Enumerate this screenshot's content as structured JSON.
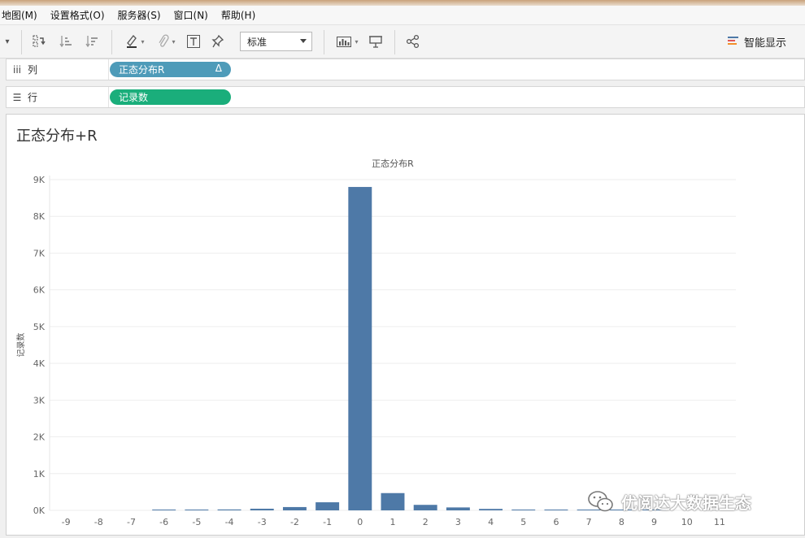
{
  "menu": [
    "地图(M)",
    "设置格式(O)",
    "服务器(S)",
    "窗口(N)",
    "帮助(H)"
  ],
  "toolbar": {
    "mark_size_value": "标准",
    "show_me_label": "智能显示"
  },
  "shelves": {
    "columns": {
      "label": "列",
      "pill": "正态分布R",
      "pill_suffix": "Δ",
      "pill_color": "#4e9bb9"
    },
    "rows": {
      "label": "行",
      "pill": "记录数",
      "pill_color": "#1aae7b"
    }
  },
  "sheet": {
    "title": "正态分布+R"
  },
  "chart_data": {
    "type": "bar",
    "header": "正态分布R",
    "ylabel": "记录数",
    "categories": [
      "-9",
      "-8",
      "-7",
      "-6",
      "-5",
      "-4",
      "-3",
      "-2",
      "-1",
      "0",
      "1",
      "2",
      "3",
      "4",
      "5",
      "6",
      "7",
      "8",
      "9",
      "10",
      "11"
    ],
    "values": [
      0,
      0,
      0,
      1,
      20,
      25,
      45,
      90,
      220,
      8800,
      470,
      150,
      80,
      40,
      20,
      10,
      5,
      2,
      1,
      0,
      0
    ],
    "y_ticks": [
      0,
      1000,
      2000,
      3000,
      4000,
      5000,
      6000,
      7000,
      8000,
      9000
    ],
    "y_tick_labels": [
      "0K",
      "1K",
      "2K",
      "3K",
      "4K",
      "5K",
      "6K",
      "7K",
      "8K",
      "9K"
    ],
    "ylim": [
      0,
      9000
    ],
    "bar_color": "#4e79a7",
    "grid": true
  },
  "watermark": {
    "text": "优阅达大数据生态"
  }
}
